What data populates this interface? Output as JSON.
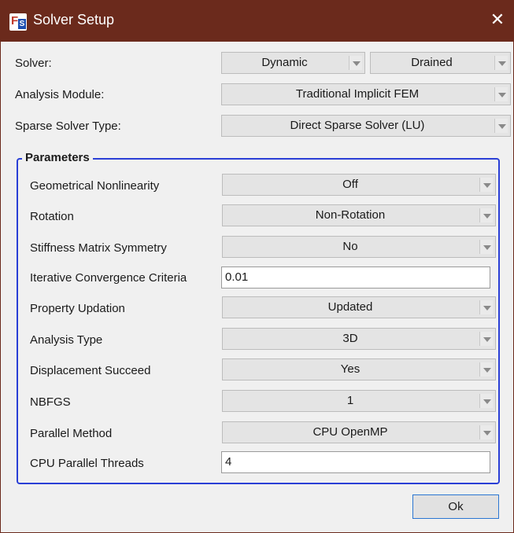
{
  "window": {
    "title": "Solver Setup",
    "close_glyph": "✕",
    "icon": "fs-app-icon",
    "icon_text_f": "F",
    "icon_text_s": "S"
  },
  "top": {
    "solver_label": "Solver:",
    "solver_value1": "Dynamic",
    "solver_value2": "Drained",
    "analysis_label": "Analysis Module:",
    "analysis_value": "Traditional Implicit FEM",
    "sparse_label": "Sparse Solver Type:",
    "sparse_value": "Direct Sparse Solver (LU)"
  },
  "parameters": {
    "title": "Parameters",
    "rows": [
      {
        "label": "Geometrical Nonlinearity",
        "value": "Off"
      },
      {
        "label": "Rotation",
        "value": "Non-Rotation"
      },
      {
        "label": "Stiffness Matrix Symmetry",
        "value": "No"
      },
      {
        "label": "Iterative Convergence Criteria",
        "value": "0.01"
      },
      {
        "label": "Property Updation",
        "value": "Updated"
      },
      {
        "label": "Analysis Type",
        "value": "3D"
      },
      {
        "label": "Displacement Succeed",
        "value": "Yes"
      },
      {
        "label": "NBFGS",
        "value": "1"
      },
      {
        "label": "Parallel Method",
        "value": "CPU OpenMP"
      },
      {
        "label": "CPU Parallel Threads",
        "value": "4"
      }
    ]
  },
  "ok_label": "Ok",
  "colors": {
    "titlebar": "#6b2a1c",
    "group_border": "#2a3fd6",
    "focus_border": "#2a76d2"
  }
}
